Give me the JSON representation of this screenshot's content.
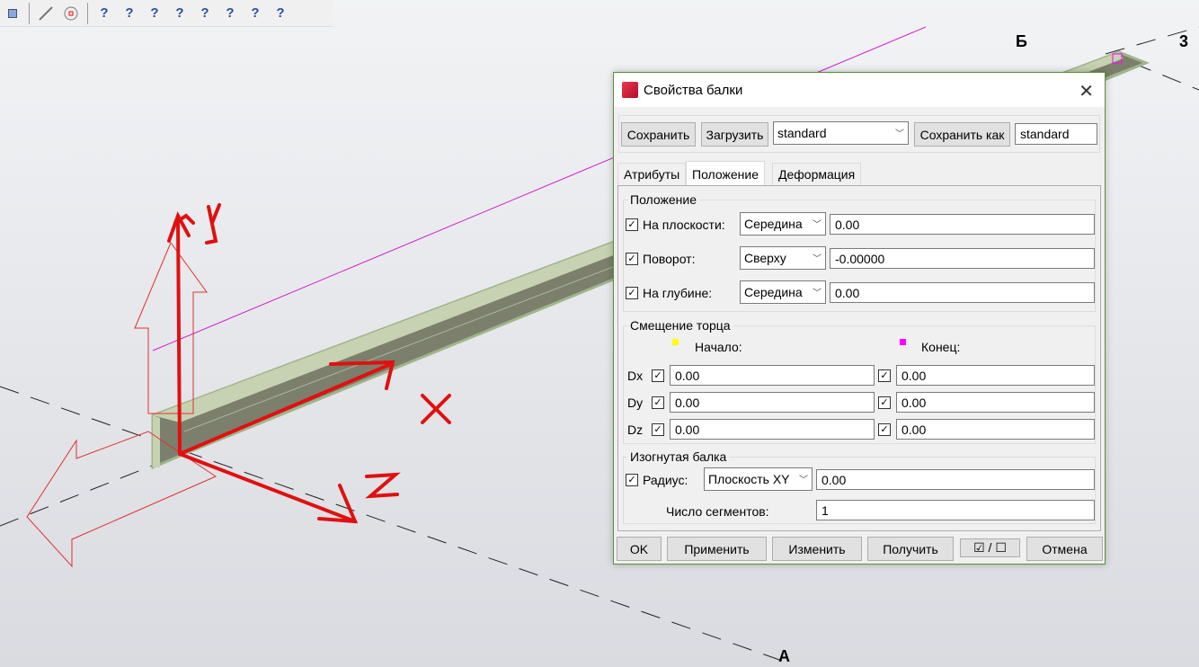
{
  "toolbar": {
    "icons": [
      "snap-point-icon",
      "snap-line-icon",
      "snap-circle-icon",
      "query-object-icon",
      "query-beam-icon",
      "query-part-icon",
      "query-weld-icon",
      "query-group-icon",
      "query-component-icon",
      "query-assembly-icon",
      "query-3d-icon"
    ],
    "query_glyph": "?"
  },
  "viewport": {
    "grid_labels": [
      "Б",
      "3",
      "А"
    ],
    "annotations": [
      "Y",
      "X",
      "Z"
    ]
  },
  "dialog": {
    "title": "Свойства балки",
    "close": "✕",
    "save": "Сохранить",
    "load": "Загрузить",
    "preset": "standard",
    "save_as": "Сохранить как",
    "save_as_name": "standard",
    "tabs": [
      "Атрибуты",
      "Положение",
      "Деформация"
    ],
    "position": {
      "group": "Положение",
      "rows": [
        {
          "label": "На плоскости:",
          "option": "Середина",
          "value": "0.00"
        },
        {
          "label": "Поворот:",
          "option": "Сверху",
          "value": "-0.00000"
        },
        {
          "label": "На глубине:",
          "option": "Середина",
          "value": "0.00"
        }
      ]
    },
    "end_offset": {
      "group": "Смещение торца",
      "start": "Начало:",
      "end": "Конец:",
      "start_color": "#ffff00",
      "end_color": "#ff00ff",
      "rows": [
        {
          "label": "Dx",
          "start": "0.00",
          "end": "0.00"
        },
        {
          "label": "Dy",
          "start": "0.00",
          "end": "0.00"
        },
        {
          "label": "Dz",
          "start": "0.00",
          "end": "0.00"
        }
      ]
    },
    "curved": {
      "group": "Изогнутая балка",
      "radius_label": "Радиус:",
      "plane": "Плоскость XY",
      "radius": "0.00",
      "segments_label": "Число сегментов:",
      "segments": "1"
    },
    "footer": {
      "ok": "OK",
      "apply": "Применить",
      "modify": "Изменить",
      "get": "Получить",
      "toggle": "☑ / ☐",
      "cancel": "Отмена"
    }
  }
}
